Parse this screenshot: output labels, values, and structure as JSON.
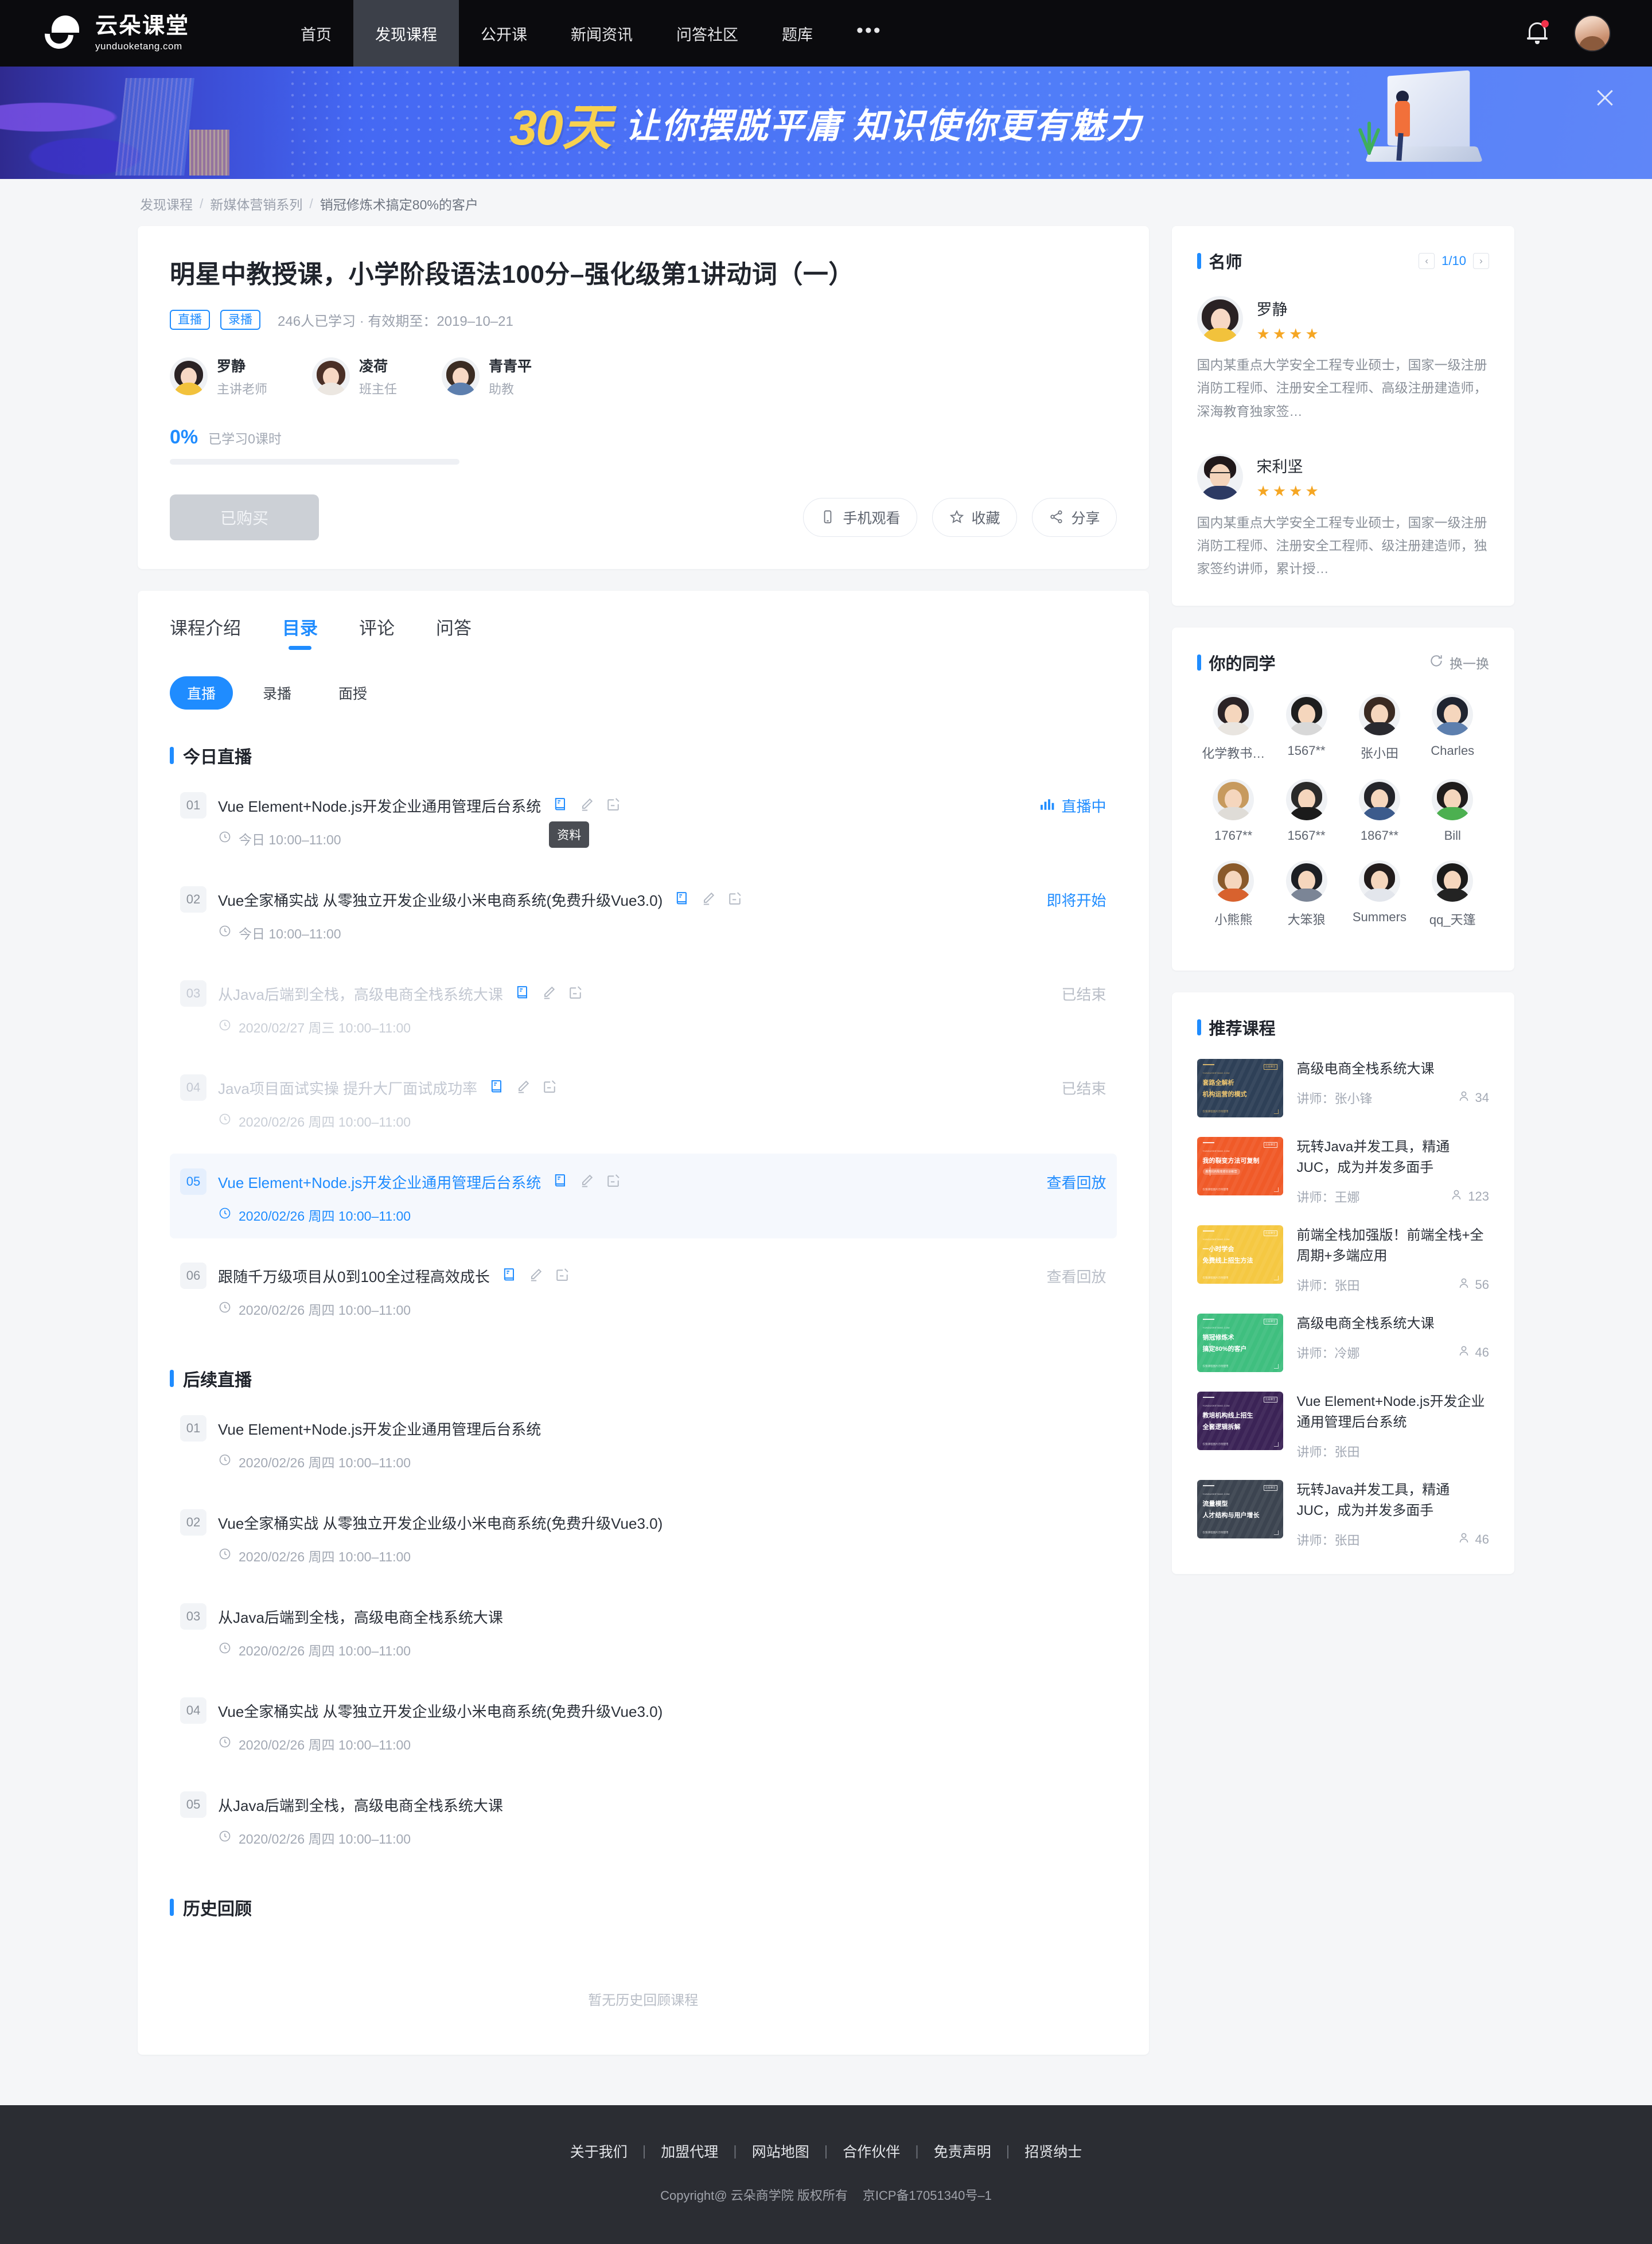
{
  "header": {
    "logo_cn": "云朵课堂",
    "logo_en": "yunduoketang.com",
    "nav": [
      {
        "label": "首页",
        "active": false
      },
      {
        "label": "发现课程",
        "active": true
      },
      {
        "label": "公开课",
        "active": false
      },
      {
        "label": "新闻资讯",
        "active": false
      },
      {
        "label": "问答社区",
        "active": false
      },
      {
        "label": "题库",
        "active": false
      }
    ],
    "more": "•••",
    "bell_icon": "bell-icon",
    "avatar_icon": "user-avatar"
  },
  "banner": {
    "highlight": "30天",
    "text": "让你摆脱平庸  知识使你更有魅力",
    "close_icon": "close-icon"
  },
  "breadcrumb": {
    "items": [
      "发现课程",
      "新媒体营销系列",
      "销冠修炼术搞定80%的客户"
    ],
    "separator": "/"
  },
  "course": {
    "title": "明星中教授课，小学阶段语法100分–强化级第1讲动词（一）",
    "tags": [
      "直播",
      "录播"
    ],
    "meta": "246人已学习 · 有效期至：2019–10–21",
    "teachers": [
      {
        "name": "罗静",
        "role": "主讲老师"
      },
      {
        "name": "凌荷",
        "role": "班主任"
      },
      {
        "name": "青青平",
        "role": "助教"
      }
    ],
    "progress_pct": "0%",
    "progress_label": "已学习0课时",
    "progress_value": 0,
    "buy_button": "已购买",
    "actions": [
      {
        "label": "手机观看",
        "icon": "phone-icon"
      },
      {
        "label": "收藏",
        "icon": "star-icon"
      },
      {
        "label": "分享",
        "icon": "share-icon"
      }
    ]
  },
  "tabs": [
    {
      "label": "课程介绍",
      "active": false
    },
    {
      "label": "目录",
      "active": true
    },
    {
      "label": "评论",
      "active": false
    },
    {
      "label": "问答",
      "active": false
    }
  ],
  "subtabs": [
    {
      "label": "直播",
      "active": true
    },
    {
      "label": "录播",
      "active": false
    },
    {
      "label": "面授",
      "active": false
    }
  ],
  "lesson_icons": {
    "material": "book-icon",
    "homework": "pencil-icon",
    "test": "note-edit-icon",
    "tooltip": "资料"
  },
  "sections": [
    {
      "title": "今日直播",
      "lessons": [
        {
          "idx": "01",
          "name": "Vue Element+Node.js开发企业通用管理后台系统",
          "time": "今日 10:00–11:00",
          "status": "直播中",
          "status_type": "live",
          "icons": true,
          "tooltip": true,
          "state": "normal"
        },
        {
          "idx": "02",
          "name": "Vue全家桶实战 从零独立开发企业级小米电商系统(免费升级Vue3.0)",
          "time": "今日 10:00–11:00",
          "status": "即将开始",
          "status_type": "soon",
          "icons": true,
          "state": "normal"
        },
        {
          "idx": "03",
          "name": "从Java后端到全栈，高级电商全栈系统大课",
          "time": "2020/02/27 周三 10:00–11:00",
          "status": "已结束",
          "status_type": "end",
          "icons": true,
          "state": "muted"
        },
        {
          "idx": "04",
          "name": "Java项目面试实操 提升大厂面试成功率",
          "time": "2020/02/26 周四 10:00–11:00",
          "status": "已结束",
          "status_type": "end",
          "icons": true,
          "state": "muted"
        },
        {
          "idx": "05",
          "name": "Vue Element+Node.js开发企业通用管理后台系统",
          "time": "2020/02/26 周四 10:00–11:00",
          "status": "查看回放",
          "status_type": "replay",
          "icons": true,
          "state": "highlight"
        },
        {
          "idx": "06",
          "name": "跟随千万级项目从0到100全过程高效成长",
          "time": "2020/02/26 周四 10:00–11:00",
          "status": "查看回放",
          "status_type": "replay-dim",
          "icons": true,
          "state": "normal"
        }
      ]
    },
    {
      "title": "后续直播",
      "lessons": [
        {
          "idx": "01",
          "name": "Vue Element+Node.js开发企业通用管理后台系统",
          "time": "2020/02/26 周四 10:00–11:00",
          "status": "",
          "status_type": "none",
          "icons": false,
          "state": "normal"
        },
        {
          "idx": "02",
          "name": "Vue全家桶实战 从零独立开发企业级小米电商系统(免费升级Vue3.0)",
          "time": "2020/02/26 周四 10:00–11:00",
          "status": "",
          "status_type": "none",
          "icons": false,
          "state": "normal"
        },
        {
          "idx": "03",
          "name": "从Java后端到全栈，高级电商全栈系统大课",
          "time": "2020/02/26 周四 10:00–11:00",
          "status": "",
          "status_type": "none",
          "icons": false,
          "state": "normal"
        },
        {
          "idx": "04",
          "name": "Vue全家桶实战 从零独立开发企业级小米电商系统(免费升级Vue3.0)",
          "time": "2020/02/26 周四 10:00–11:00",
          "status": "",
          "status_type": "none",
          "icons": false,
          "state": "normal"
        },
        {
          "idx": "05",
          "name": "从Java后端到全栈，高级电商全栈系统大课",
          "time": "2020/02/26 周四 10:00–11:00",
          "status": "",
          "status_type": "none",
          "icons": false,
          "state": "normal"
        }
      ]
    },
    {
      "title": "历史回顾",
      "lessons": [],
      "empty_text": "暂无历史回顾课程"
    }
  ],
  "famous_teachers": {
    "title": "名师",
    "page": "1/10",
    "prev_icon": "chevron-left-icon",
    "next_icon": "chevron-right-icon",
    "list": [
      {
        "name": "罗静",
        "stars": 4,
        "desc": "国内某重点大学安全工程专业硕士，国家一级注册消防工程师、注册安全工程师、高级注册建造师，深海教育独家签…"
      },
      {
        "name": "宋利坚",
        "stars": 4,
        "desc": "国内某重点大学安全工程专业硕士，国家一级注册消防工程师、注册安全工程师、级注册建造师，独家签约讲师，累计授…"
      }
    ]
  },
  "classmates": {
    "title": "你的同学",
    "refresh_label": "换一换",
    "refresh_icon": "refresh-icon",
    "list": [
      {
        "name": "化学教书…"
      },
      {
        "name": "1567**"
      },
      {
        "name": "张小田"
      },
      {
        "name": "Charles"
      },
      {
        "name": "1767**"
      },
      {
        "name": "1567**"
      },
      {
        "name": "1867**"
      },
      {
        "name": "Bill"
      },
      {
        "name": "小熊熊"
      },
      {
        "name": "大笨狼"
      },
      {
        "name": "Summers"
      },
      {
        "name": "qq_天篷"
      }
    ]
  },
  "recommended": {
    "title": "推荐课程",
    "teacher_prefix": "讲师：",
    "people_icon": "person-icon",
    "list": [
      {
        "title": "高级电商全栈系统大课",
        "teacher": "张小锋",
        "count": "34",
        "thumb": {
          "bg": "#2e4057",
          "fg": "#f0c770",
          "l1": "套路全解析",
          "l2": "机构运营的模式",
          "pill": "",
          "bottom": "仅限课程图片示例使用",
          "badge": "云朵课堂",
          "logo": "YUNDUOKETANG.COM"
        }
      },
      {
        "title": "玩转Java并发工具，精通JUC，成为并发多面手",
        "teacher": "王娜",
        "count": "123",
        "thumb": {
          "bg": "#f05a28",
          "fg": "#ffffff",
          "l1": "我的裂变方法可复制",
          "l2": "",
          "pill": "教育机构裂变增长训练营",
          "bottom": "仅限课程图片示例使用",
          "badge": "云朵课堂",
          "logo": "YUNDUOKETANG.COM"
        }
      },
      {
        "title": "前端全栈加强版！前端全栈+全周期+多端应用",
        "teacher": "张田",
        "count": "56",
        "thumb": {
          "bg": "#f5c842",
          "fg": "#ffffff",
          "l1": "一小时学会",
          "l2": "免费线上招生方法",
          "pill": "",
          "bottom": "仅限课程图片示例使用",
          "badge": "云朵课堂",
          "logo": "YUNDUOKETANG.COM"
        }
      },
      {
        "title": "高级电商全栈系统大课",
        "teacher": "冷娜",
        "count": "46",
        "thumb": {
          "bg": "#3fbf7f",
          "fg": "#ffffff",
          "l1": "销冠修炼术",
          "l2": "搞定80%的客户",
          "pill": "",
          "bottom": "仅限课程图片示例使用",
          "badge": "云朵课堂",
          "logo": "YUNDUOKETANG.COM"
        }
      },
      {
        "title": "Vue Element+Node.js开发企业通用管理后台系统",
        "teacher": "张田",
        "count": "",
        "thumb": {
          "bg": "#3b2356",
          "fg": "#ffffff",
          "l1": "教培机构线上招生",
          "l2": "全套逻辑拆解",
          "pill": "",
          "bottom": "仅限课程图片示例使用",
          "badge": "云朵课堂",
          "logo": "YUNDUOKETANG.COM"
        }
      },
      {
        "title": "玩转Java并发工具，精通JUC，成为并发多面手",
        "teacher": "张田",
        "count": "46",
        "thumb": {
          "bg": "#3c4450",
          "fg": "#ffffff",
          "l1": "流量模型",
          "l2": "人才结构与用户增长",
          "pill": "",
          "bottom": "仅限课程图片示例使用",
          "badge": "云朵课堂",
          "logo": "YUNDUOKETANG.COM"
        }
      }
    ]
  },
  "footer": {
    "links": [
      "关于我们",
      "加盟代理",
      "网站地图",
      "合作伙伴",
      "免责声明",
      "招贤纳士"
    ],
    "separator": "|",
    "copyright": "Copyright@ 云朵商学院   版权所有",
    "icp": "京ICP备17051340号–1"
  },
  "colors": {
    "accent": "#1f8cff",
    "star": "#f5a623",
    "header_bg": "#0b0b0e",
    "footer_bg": "#2b2d33"
  }
}
